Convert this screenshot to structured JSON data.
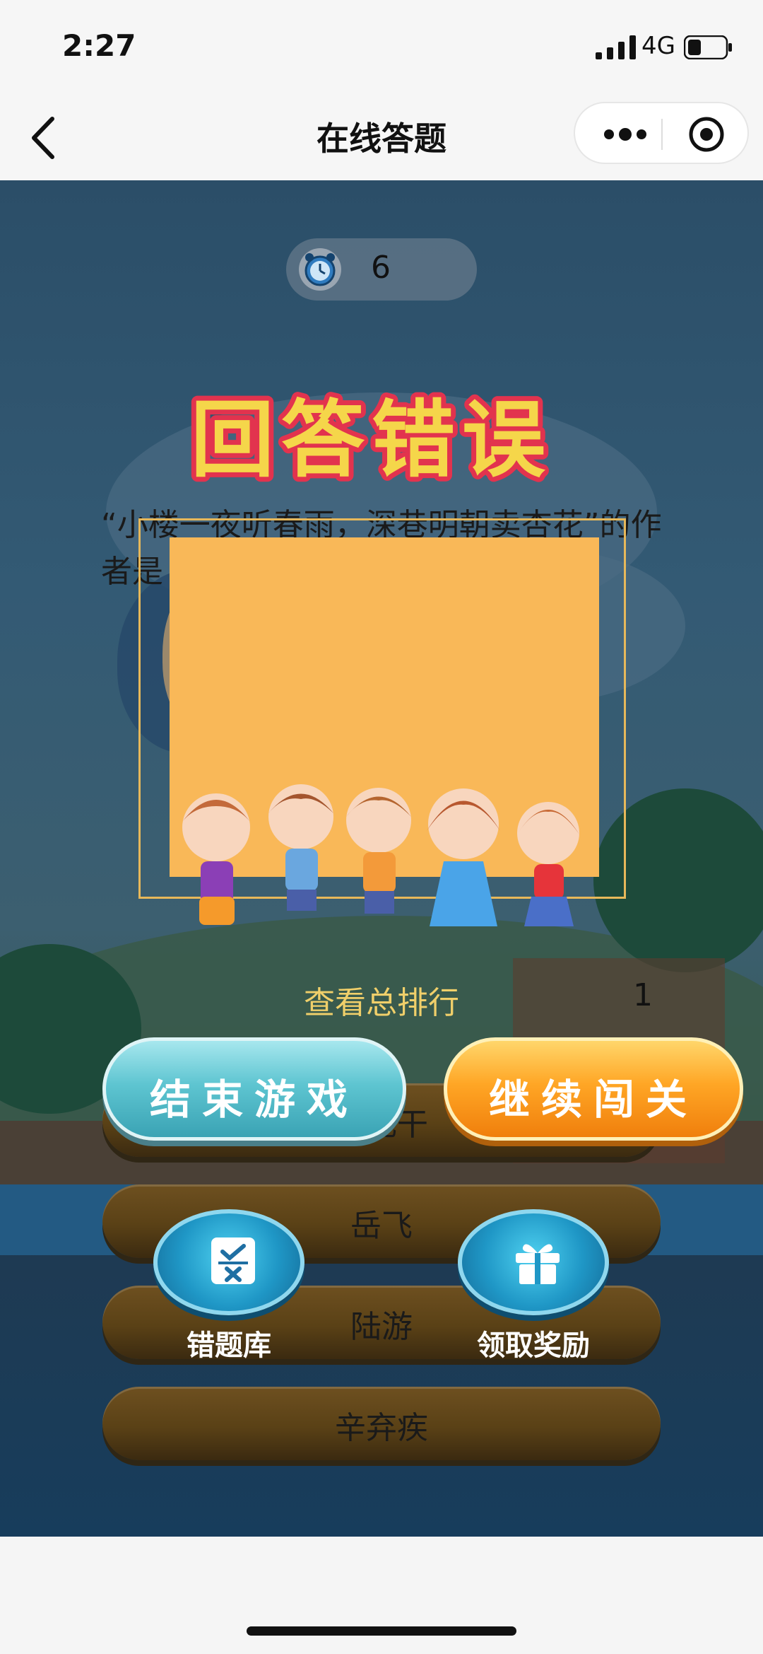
{
  "status_bar": {
    "time": "2:27",
    "network": "4G"
  },
  "nav": {
    "title": "在线答题"
  },
  "timer": {
    "value": "6"
  },
  "overlay": {
    "title": "回答错误"
  },
  "question": {
    "text": "“小楼一夜听春雨，深巷明朝卖杏花”的作者是"
  },
  "options": [
    "张元干",
    "岳飞",
    "陆游",
    "辛弃疾"
  ],
  "ranking": {
    "link": "查看总排行",
    "rank": "1"
  },
  "actions": {
    "end_game": "结束游戏",
    "continue": "继续闯关",
    "wrong_bank": "错题库",
    "reward": "领取奖励"
  },
  "colors": {
    "title_fill": "#f5d64a",
    "title_stroke": "#e2334e",
    "rank_link": "#f0cf6a",
    "panel": "#f9b858"
  }
}
